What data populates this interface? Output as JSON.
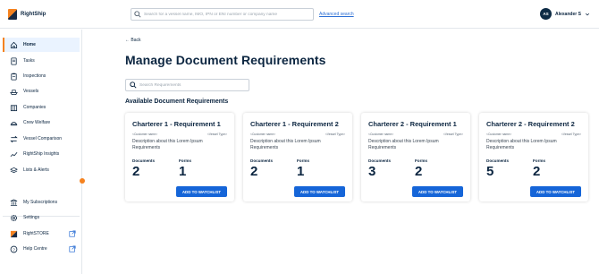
{
  "app": {
    "brand": "RightShip"
  },
  "header": {
    "search_placeholder": "Search for a vessel name, IMO, IPN or ENI number or company name",
    "advanced_search": "Advanced search",
    "user_initials": "AS",
    "user_name": "Alexander S"
  },
  "sidebar": {
    "items": [
      {
        "label": "Home",
        "icon": "home-icon",
        "active": true
      },
      {
        "label": "Tasks",
        "icon": "document-icon"
      },
      {
        "label": "Inspections",
        "icon": "clipboard-icon"
      },
      {
        "label": "Vessels",
        "icon": "ship-icon"
      },
      {
        "label": "Companies",
        "icon": "building-icon"
      },
      {
        "label": "Crew Welfare",
        "icon": "crew-icon"
      },
      {
        "label": "Vessel Comparison",
        "icon": "compare-icon"
      },
      {
        "label": "RightShip Insights",
        "icon": "trend-icon"
      },
      {
        "label": "Lists & Alerts",
        "icon": "layers-icon"
      }
    ],
    "bottom_items": [
      {
        "label": "My Subscriptions",
        "icon": "bank-icon"
      },
      {
        "label": "Settings",
        "icon": "gear-icon"
      },
      {
        "label": "RightSTORE",
        "icon": "store-logo-icon",
        "external": true
      },
      {
        "label": "Help Centre",
        "icon": "help-icon",
        "external": true
      }
    ]
  },
  "main": {
    "back_label": "← Back",
    "title": "Manage Document Requirements",
    "search_placeholder": "Search Requirements",
    "section_title": "Available Document Requirements",
    "cards": [
      {
        "title": "Charterer 1 - Requirement 1",
        "customer": "<Customer name>",
        "vessel_type": "<Vessel Type>",
        "description": "Description about this Lorem Ipsum Requirements",
        "documents_label": "Documents",
        "documents_count": "2",
        "forms_label": "Forms",
        "forms_count": "1",
        "button": "ADD TO WATCHLIST"
      },
      {
        "title": "Charterer 1 - Requirement 2",
        "customer": "<Customer name>",
        "vessel_type": "<Vessel Type>",
        "description": "Description about this Lorem Ipsum Requirements",
        "documents_label": "Documents",
        "documents_count": "2",
        "forms_label": "Forms",
        "forms_count": "1",
        "button": "ADD TO WATCHLIST"
      },
      {
        "title": "Charterer 2 - Requirement 1",
        "customer": "<Customer name>",
        "vessel_type": "<Vessel Type>",
        "description": "Description about this Lorem Ipsum Requirements",
        "documents_label": "Documents",
        "documents_count": "3",
        "forms_label": "Forms",
        "forms_count": "2",
        "button": "ADD TO WATCHLIST"
      },
      {
        "title": "Charterer 2 - Requirement 2",
        "customer": "<Customer name>",
        "vessel_type": "<Vessel Type>",
        "description": "Description about this Lorem Ipsum Requirements",
        "documents_label": "Documents",
        "documents_count": "5",
        "forms_label": "Forms",
        "forms_count": "2",
        "button": "ADD TO WATCHLIST"
      }
    ]
  },
  "colors": {
    "accent": "#f5821f",
    "primary": "#1565d8",
    "text": "#0b2540",
    "active_bg": "#eaf3ff"
  }
}
